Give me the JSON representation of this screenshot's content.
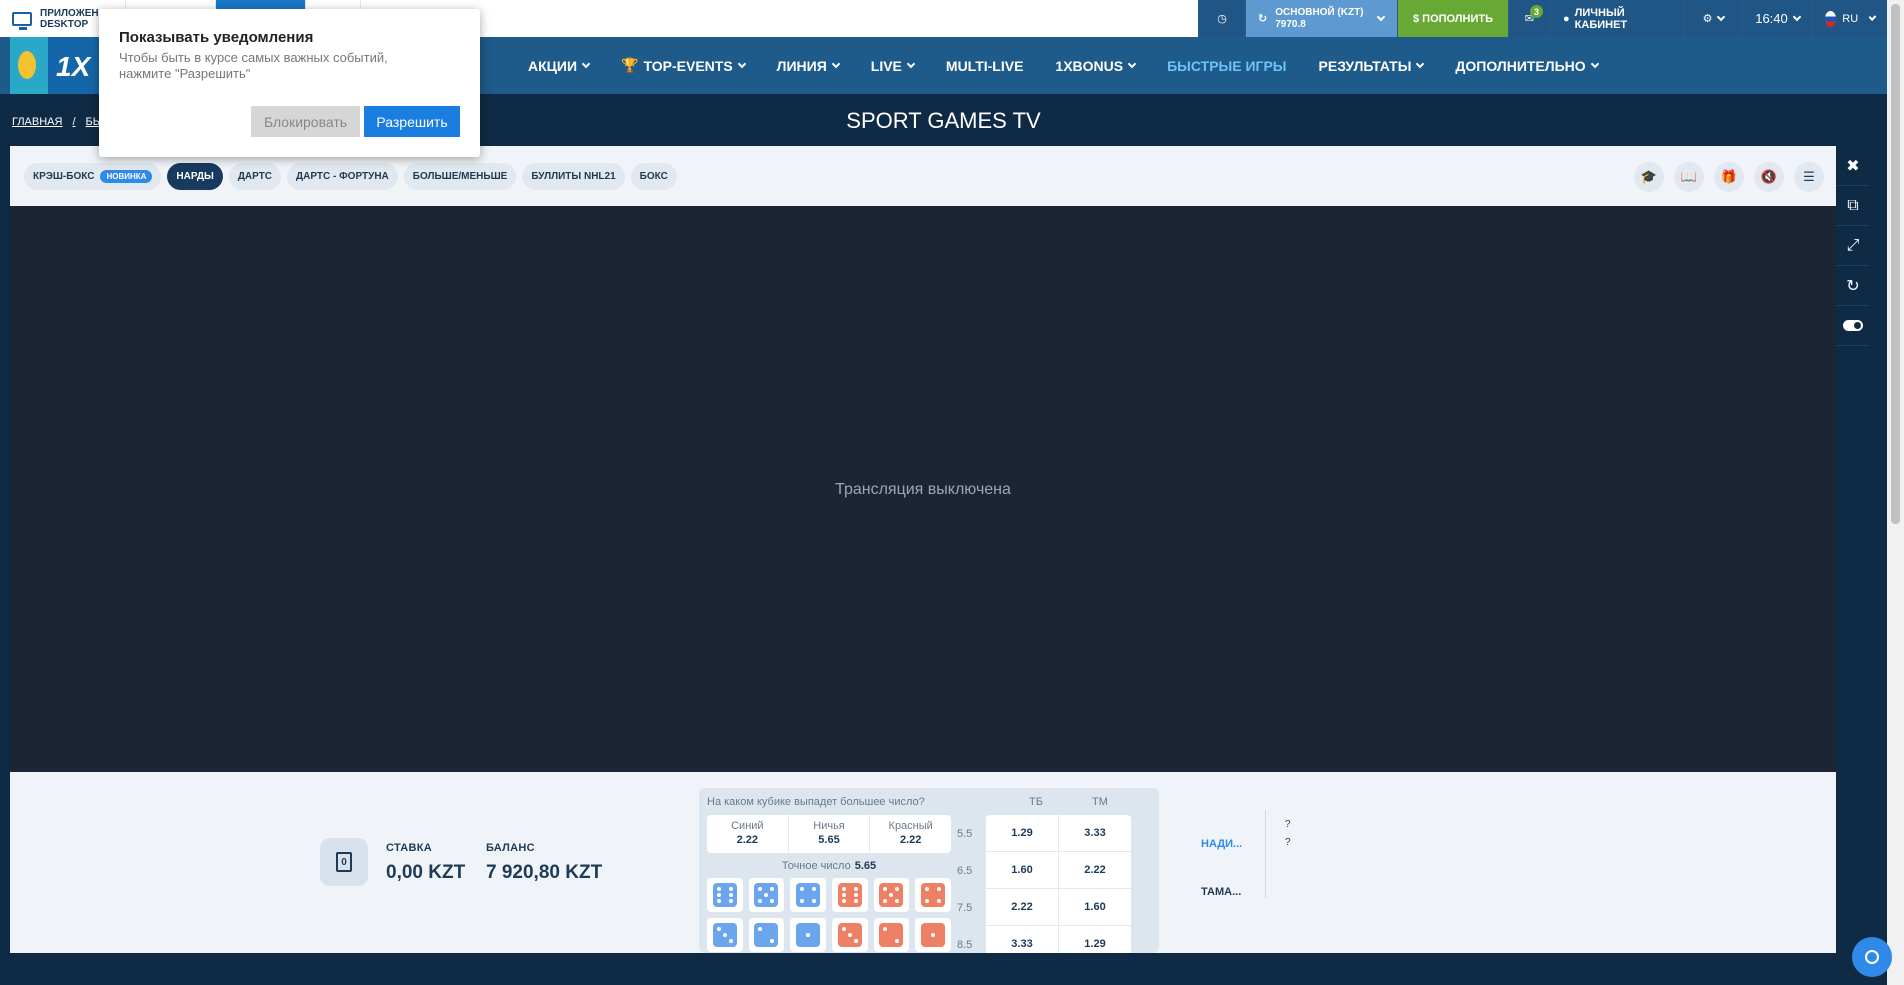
{
  "topbar": {
    "app_label_line1": "ПРИЛОЖЕН",
    "app_label_line2": "DESKTOP",
    "account_label": "ОСНОВНОЙ (KZT)",
    "account_balance": "7970.8",
    "topup_label": "$ ПОПОЛНИТЬ",
    "mail_badge": "3",
    "cabinet_label": "ЛИЧНЫЙ КАБИНЕТ",
    "time": "16:40",
    "language": "RU"
  },
  "nav": {
    "items": [
      {
        "label": "АКЦИИ",
        "dropdown": true
      },
      {
        "label": "TOP-EVENTS",
        "dropdown": true,
        "icon": "trophy-icon"
      },
      {
        "label": "ЛИНИЯ",
        "dropdown": true
      },
      {
        "label": "LIVE",
        "dropdown": true
      },
      {
        "label": "MULTI-LIVE",
        "dropdown": false
      },
      {
        "label": "1XBONUS",
        "dropdown": true
      },
      {
        "label": "БЫСТРЫЕ ИГРЫ",
        "dropdown": false,
        "active": true
      },
      {
        "label": "РЕЗУЛЬТАТЫ",
        "dropdown": true
      },
      {
        "label": "ДОПОЛНИТЕЛЬНО",
        "dropdown": true
      }
    ]
  },
  "breadcrumb": {
    "home": "ГЛАВНАЯ",
    "sep": "/",
    "current": "БЫ"
  },
  "page_title": "SPORT GAMES TV",
  "notification": {
    "title": "Показывать уведомления",
    "text": "Чтобы быть в курсе самых важных событий, нажмите \"Разрешить\"",
    "block_label": "Блокировать",
    "allow_label": "Разрешить"
  },
  "game_tabs": [
    {
      "label": "КРЭШ-БОКС",
      "badge": "НОВИНКА"
    },
    {
      "label": "НАРДЫ",
      "active": true
    },
    {
      "label": "ДАРТС"
    },
    {
      "label": "ДАРТС - ФОРТУНА"
    },
    {
      "label": "БОЛЬШЕ/МЕНЬШЕ"
    },
    {
      "label": "БУЛЛИТЫ NHL21"
    },
    {
      "label": "БОКС"
    }
  ],
  "stream_message": "Трансляция выключена",
  "bet": {
    "stake_label": "СТАВКА",
    "stake_value": "0,00 KZT",
    "balance_label": "БАЛАНС",
    "balance_value": "7 920,80 KZT",
    "chip_value": "0"
  },
  "board": {
    "question": "На каком кубике выпадет большее число?",
    "tb_header": "ТБ",
    "tm_header": "ТМ",
    "outcomes": [
      {
        "name": "Синий",
        "odd": "2.22"
      },
      {
        "name": "Ничья",
        "odd": "5.65"
      },
      {
        "name": "Красный",
        "odd": "2.22"
      }
    ],
    "exact_label": "Точное число",
    "exact_odd": "5.65",
    "totals": [
      {
        "line": "5.5",
        "tb": "1.29",
        "tm": "3.33"
      },
      {
        "line": "6.5",
        "tb": "1.60",
        "tm": "2.22"
      },
      {
        "line": "7.5",
        "tb": "2.22",
        "tm": "1.60"
      },
      {
        "line": "8.5",
        "tb": "3.33",
        "tm": "1.29"
      }
    ],
    "dice": [
      {
        "color": "blue",
        "pips": 6
      },
      {
        "color": "blue",
        "pips": 5
      },
      {
        "color": "blue",
        "pips": 4
      },
      {
        "color": "red",
        "pips": 6
      },
      {
        "color": "red",
        "pips": 5
      },
      {
        "color": "red",
        "pips": 4
      },
      {
        "color": "blue",
        "pips": 3
      },
      {
        "color": "blue",
        "pips": 2
      },
      {
        "color": "blue",
        "pips": 1
      },
      {
        "color": "red",
        "pips": 3
      },
      {
        "color": "red",
        "pips": 2
      },
      {
        "color": "red",
        "pips": 1
      }
    ]
  },
  "players": [
    {
      "name": "НАДИ...",
      "active": true,
      "status": "?"
    },
    {
      "name": "ТАМА...",
      "active": false,
      "status": "?"
    }
  ],
  "side_tools": [
    "close-icon",
    "copy-icon",
    "expand-icon",
    "refresh-icon",
    "toggle-icon"
  ]
}
